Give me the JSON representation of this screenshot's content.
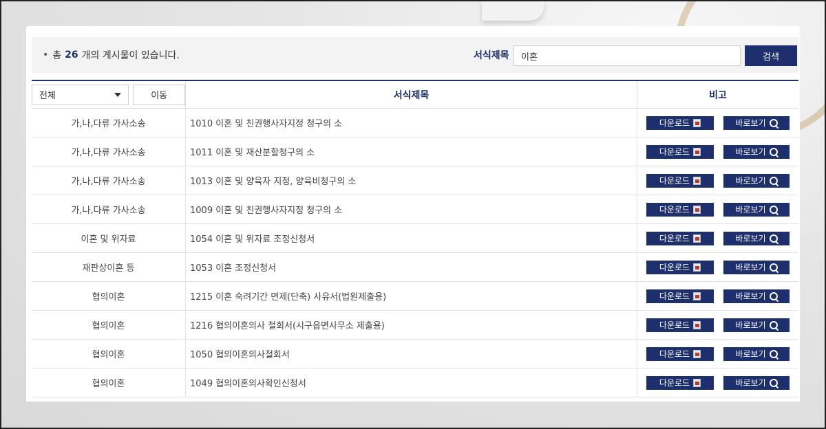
{
  "summary": {
    "bullet": "•",
    "prefix": "총",
    "count": "26",
    "suffix": "개의 게시물이 있습니다."
  },
  "search": {
    "label": "서식제목",
    "value": "이혼",
    "button_label": "검색"
  },
  "table": {
    "filter_select": "전체",
    "move_button": "이동",
    "header_title": "서식제목",
    "header_note": "비고",
    "download_label": "다운로드",
    "view_label": "바로보기",
    "rows": [
      {
        "category": "가,나,다류 가사소송",
        "title": "1010 이혼 및 친권행사자지정 청구의 소"
      },
      {
        "category": "가,나,다류 가사소송",
        "title": "1011 이혼 및 재산분할청구의 소"
      },
      {
        "category": "가,나,다류 가사소송",
        "title": "1013 이혼 및 양육자 지정, 양육비청구의 소"
      },
      {
        "category": "가,나,다류 가사소송",
        "title": "1009 이혼 및 친권행사자지정 청구의 소"
      },
      {
        "category": "이혼 및 위자료",
        "title": "1054 이혼 및 위자료 조정신청서"
      },
      {
        "category": "재판상이혼 등",
        "title": "1053 이혼 조정신청서"
      },
      {
        "category": "협의이혼",
        "title": "1215 이혼 숙려기간 면제(단축) 사유서(법원제출용)"
      },
      {
        "category": "협의이혼",
        "title": "1216 협의이혼의사 철회서(시구읍면사무소 제출용)"
      },
      {
        "category": "협의이혼",
        "title": "1050 협의이혼의사철회서"
      },
      {
        "category": "협의이혼",
        "title": "1049 협의이혼의사확인신청서"
      }
    ]
  },
  "colors": {
    "accent": "#1e2f6e",
    "panel_bg": "#ffffff",
    "search_bar_bg": "#f3f3f3"
  },
  "icons": {
    "download": "hwp-file-icon",
    "view": "magnifier-icon"
  }
}
